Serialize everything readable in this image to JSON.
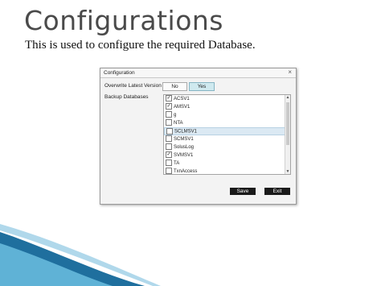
{
  "slide": {
    "title": "Configurations",
    "subtitle": "This is used to configure the required Database."
  },
  "dialog": {
    "title": "Configuration",
    "close_glyph": "×",
    "overwrite_label": "Overwrite Latest Version",
    "no_label": "No",
    "yes_label": "Yes",
    "backup_label": "Backup Databases",
    "databases": [
      {
        "name": "ACSV1",
        "checked": true,
        "mark": "✓"
      },
      {
        "name": "AMSV1",
        "checked": true,
        "mark": "✓"
      },
      {
        "name": "g",
        "checked": false,
        "mark": ""
      },
      {
        "name": "NTA",
        "checked": false,
        "mark": ""
      },
      {
        "name": "SCLMSV1",
        "checked": false,
        "mark": ""
      },
      {
        "name": "SCMSV1",
        "checked": false,
        "mark": ""
      },
      {
        "name": "SolusLog",
        "checked": false,
        "mark": ""
      },
      {
        "name": "SVMSV1",
        "checked": true,
        "mark": "✓"
      },
      {
        "name": "TA",
        "checked": false,
        "mark": ""
      },
      {
        "name": "TxnAccess",
        "checked": false,
        "mark": ""
      }
    ],
    "selected_database": "SCLMSV1",
    "save_label": "Save",
    "exit_label": "Exit"
  },
  "colors": {
    "yes_active": "#cfe9ef",
    "selection": "#dbe9f3",
    "deco_blue": "#1f6f9e",
    "deco_light": "#5fb2d6"
  },
  "icons": {
    "scroll_up": "▲",
    "scroll_down": "▼"
  }
}
